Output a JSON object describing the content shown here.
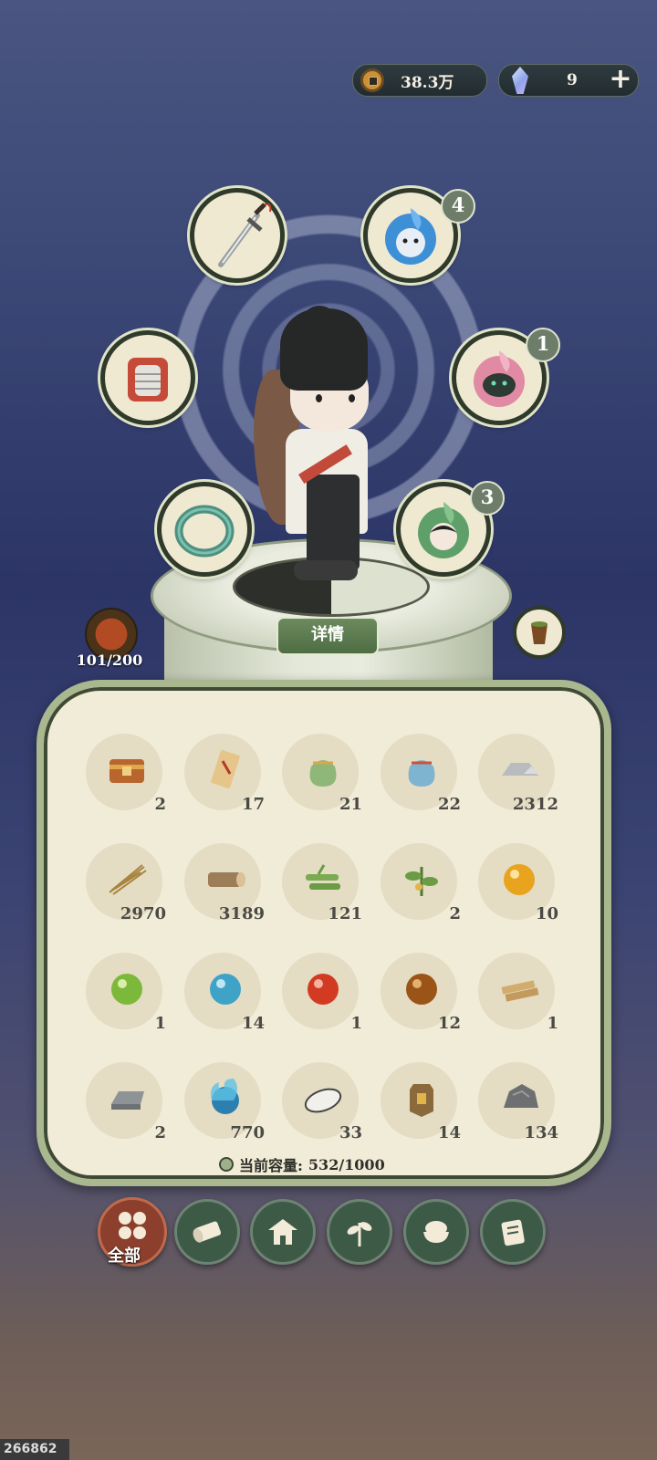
{
  "currency": {
    "coins": "38.3万",
    "gems": "9"
  },
  "equipment_slots": [
    {
      "name": "sword",
      "badge": ""
    },
    {
      "name": "spirit-ghost",
      "badge": "4"
    },
    {
      "name": "armor",
      "badge": ""
    },
    {
      "name": "spirit-dragon",
      "badge": "1"
    },
    {
      "name": "jade-bracelet",
      "badge": ""
    },
    {
      "name": "spirit-companion",
      "badge": "3"
    }
  ],
  "detail_button": "详情",
  "beast_counter": "101/200",
  "inventory": {
    "items": [
      {
        "icon": "treasure-chest",
        "count": "2"
      },
      {
        "icon": "scroll-talisman",
        "count": "17"
      },
      {
        "icon": "green-pouch",
        "count": "21"
      },
      {
        "icon": "blue-pouch",
        "count": "22"
      },
      {
        "icon": "stone",
        "count": "2312"
      },
      {
        "icon": "straw-bundle",
        "count": "2970"
      },
      {
        "icon": "log",
        "count": "3189"
      },
      {
        "icon": "bamboo",
        "count": "121"
      },
      {
        "icon": "herb",
        "count": "2"
      },
      {
        "icon": "gold-orb",
        "count": "10"
      },
      {
        "icon": "green-orb",
        "count": "1"
      },
      {
        "icon": "blue-orb",
        "count": "14"
      },
      {
        "icon": "red-orb",
        "count": "1"
      },
      {
        "icon": "brown-orb",
        "count": "12"
      },
      {
        "icon": "planks",
        "count": "1"
      },
      {
        "icon": "iron-ingot",
        "count": "2"
      },
      {
        "icon": "blue-flame-orb",
        "count": "770"
      },
      {
        "icon": "white-stone",
        "count": "33"
      },
      {
        "icon": "token-plaque",
        "count": "14"
      },
      {
        "icon": "ore-rock",
        "count": "134"
      }
    ],
    "capacity_label": "当前容量:",
    "capacity_value": "532/1000"
  },
  "tabs": [
    {
      "icon": "all-grid-icon",
      "label": "全部"
    },
    {
      "icon": "log-icon"
    },
    {
      "icon": "house-icon"
    },
    {
      "icon": "herb-icon"
    },
    {
      "icon": "rice-bowl-icon"
    },
    {
      "icon": "scroll-icon"
    }
  ],
  "watermark": "266862"
}
